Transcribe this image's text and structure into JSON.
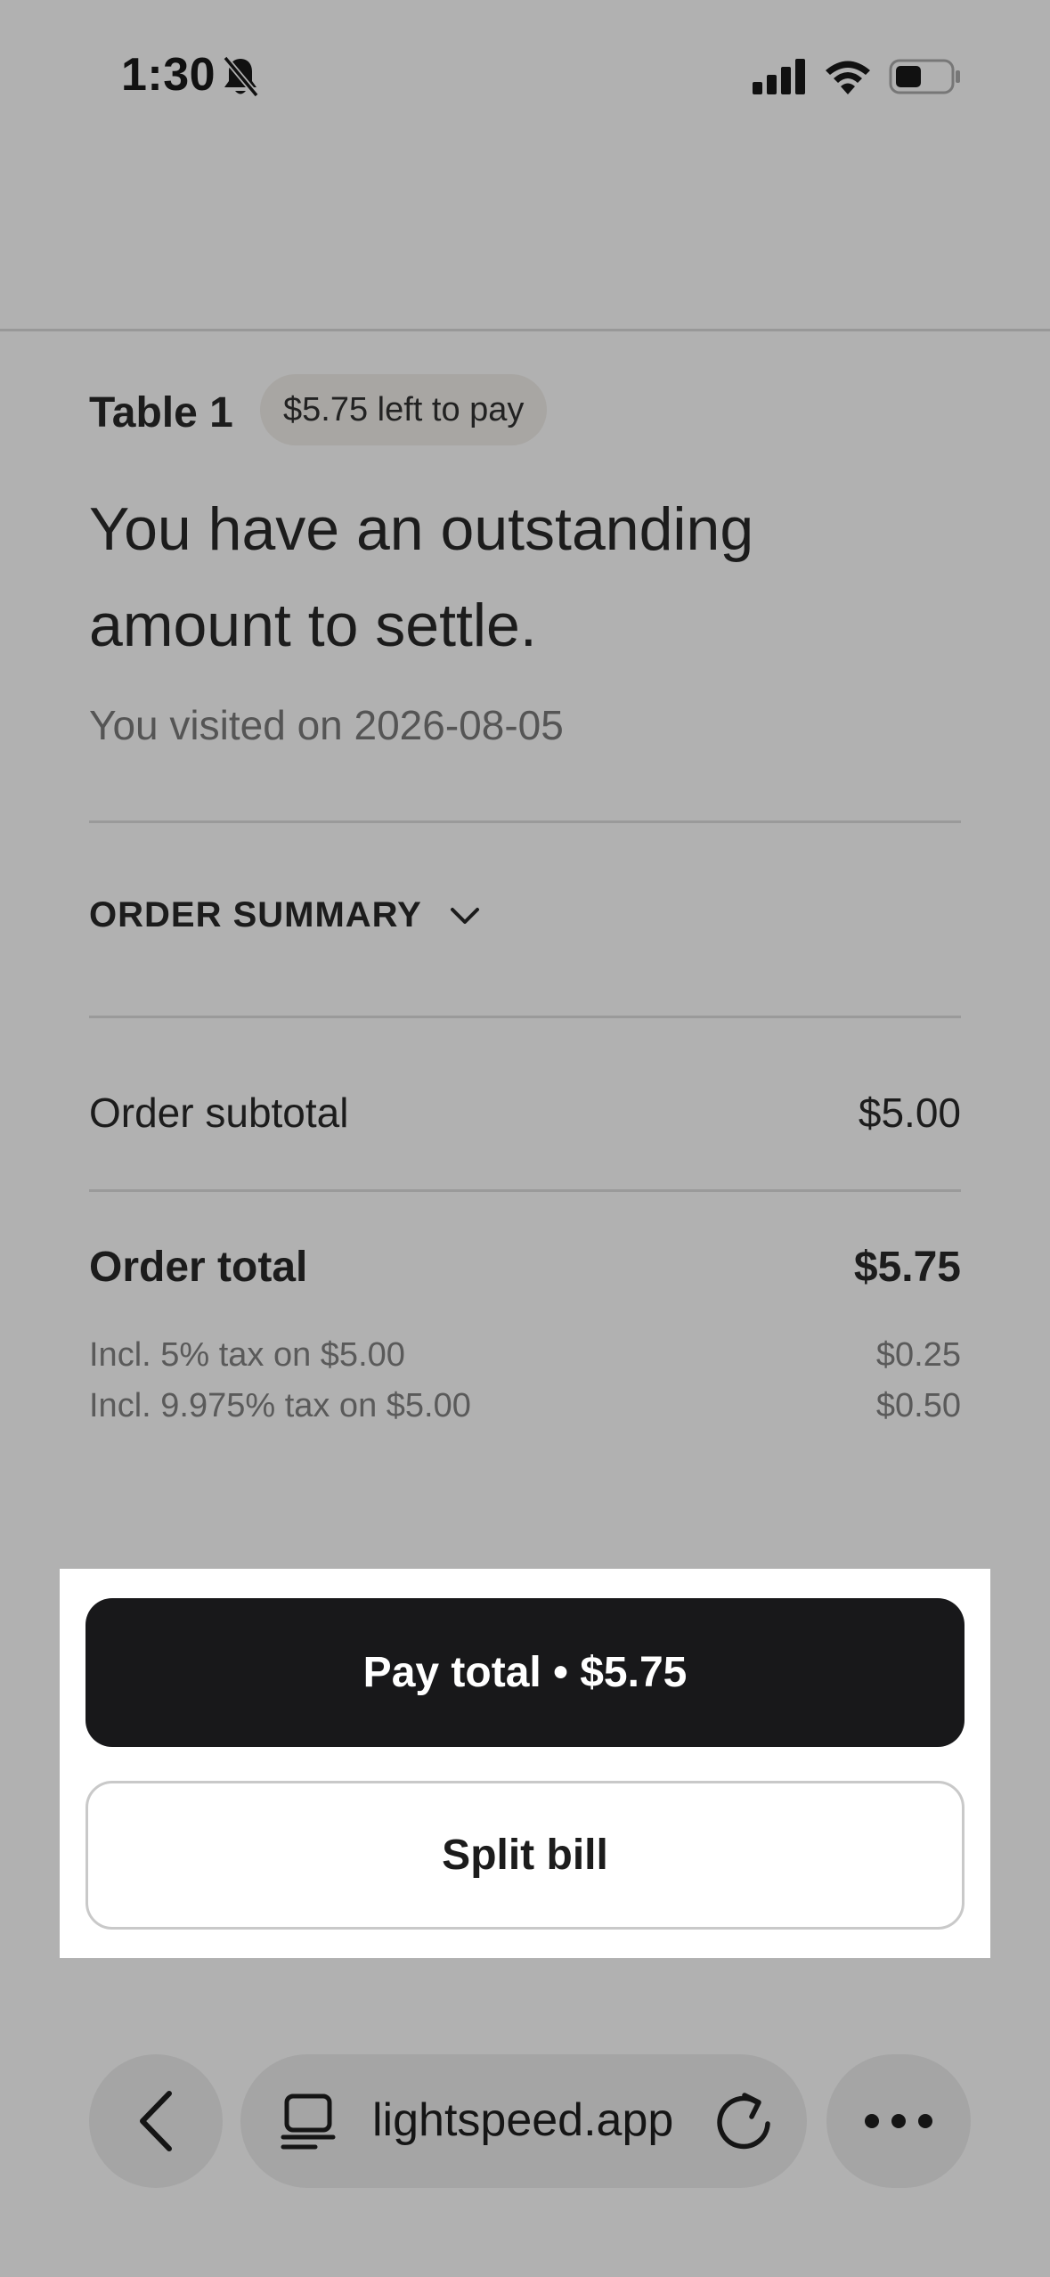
{
  "status_bar": {
    "time": "1:30",
    "icons": [
      "bell-slash-icon",
      "cellular-signal-icon",
      "wifi-icon",
      "battery-icon"
    ]
  },
  "bill": {
    "table_label": "Table 1",
    "left_to_pay_badge": "$5.75 left to pay",
    "headline": "You have an outstanding amount to settle.",
    "visited": "You visited on 2026-08-05"
  },
  "order_summary": {
    "label": "ORDER SUMMARY",
    "icon": "chevron-down-icon"
  },
  "totals": {
    "subtotal_label": "Order subtotal",
    "subtotal_value": "$5.00",
    "total_label": "Order total",
    "total_value": "$5.75",
    "taxes": [
      {
        "label": "Incl. 5% tax on $5.00",
        "value": "$0.25"
      },
      {
        "label": "Incl. 9.975% tax on $5.00",
        "value": "$0.50"
      }
    ]
  },
  "actions": {
    "pay_label": "Pay total • $5.75",
    "split_label": "Split bill"
  },
  "browser_toolbar": {
    "url": "lightspeed.app",
    "icons": [
      "back-icon",
      "tabs-icon",
      "reload-icon",
      "more-icon"
    ]
  },
  "colors": {
    "overlay_background": "#b1b1b1",
    "primary_button": "#18181a",
    "badge": "#a8a6a3"
  }
}
